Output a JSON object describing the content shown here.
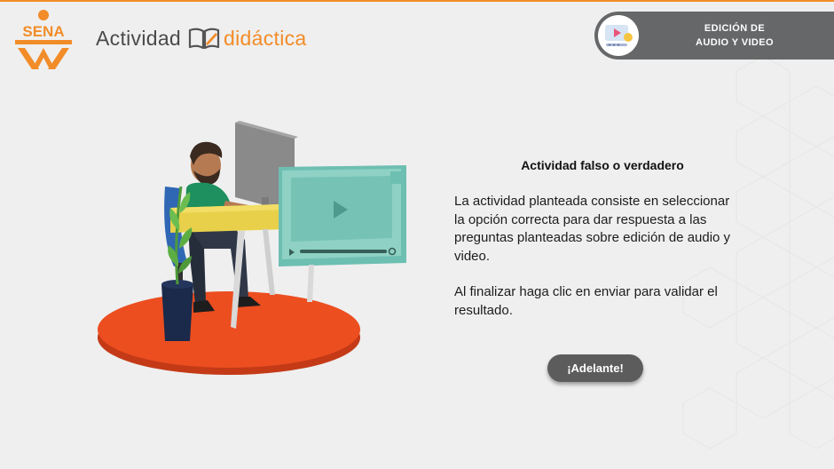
{
  "header": {
    "logo_text": "SENA",
    "brand_word_1": "Actividad",
    "brand_word_2": "didáctica",
    "module_line_1": "EDICIÓN DE",
    "module_line_2": "AUDIO Y VIDEO"
  },
  "activity": {
    "title": "Actividad falso o verdadero",
    "paragraph_1": "La actividad planteada consiste en seleccionar la opción correcta para dar respuesta a las preguntas planteadas sobre edición de audio y video.",
    "paragraph_2": "Al finalizar haga clic en enviar para validar el resultado.",
    "next_label": "¡Adelante!"
  },
  "colors": {
    "accent": "#f28c28",
    "pill": "#666769",
    "button": "#5c5c5c",
    "platform": "#ec4e20",
    "screen": "#8fd1c5"
  }
}
